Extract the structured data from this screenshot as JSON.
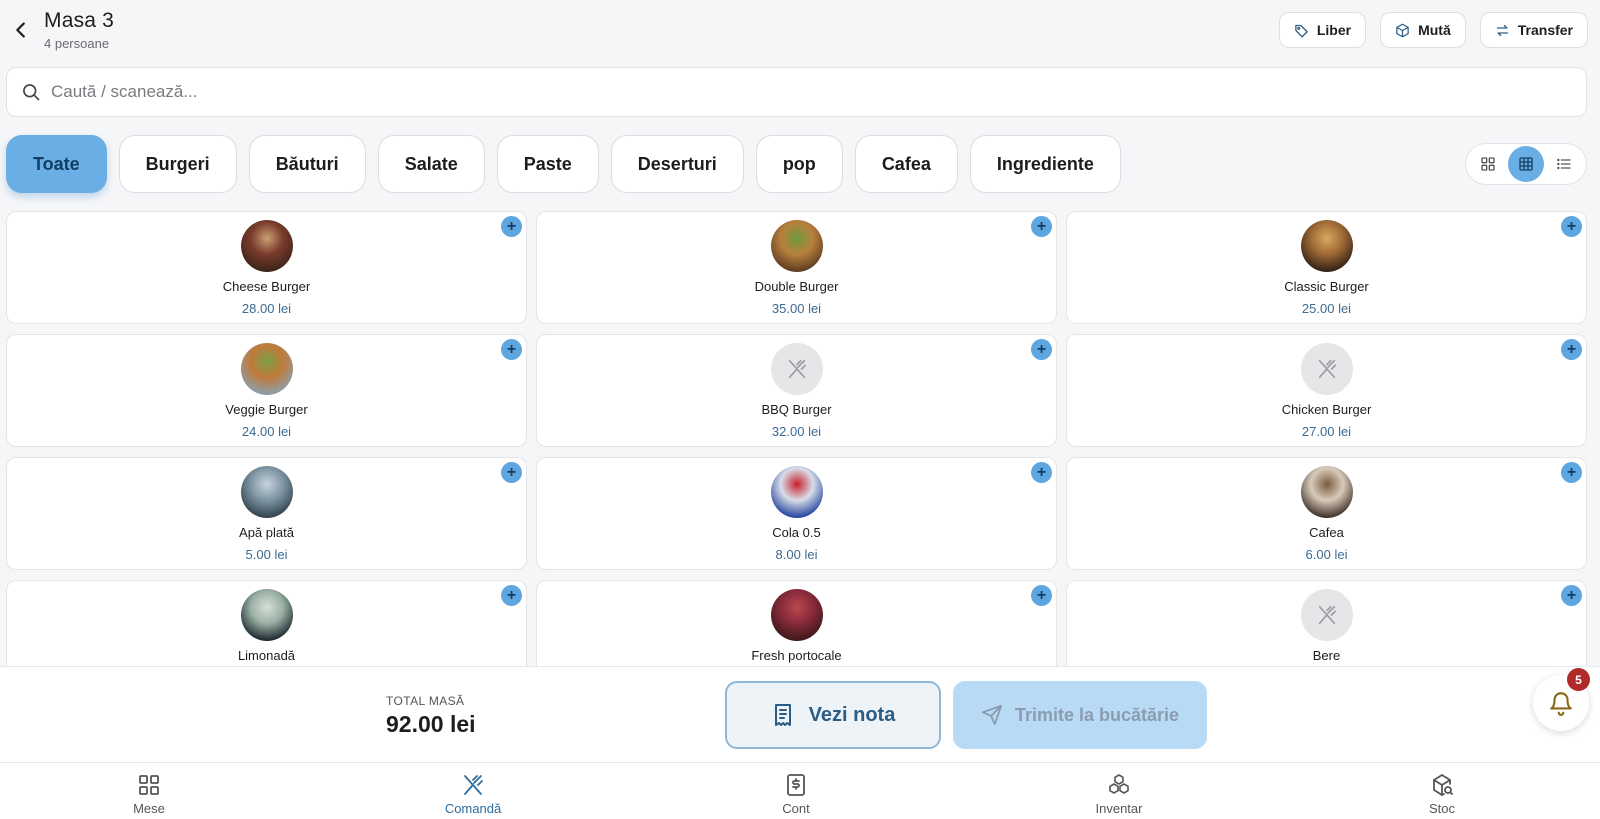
{
  "header": {
    "title": "Masa 3",
    "subtitle": "4 persoane",
    "actions": [
      {
        "label": "Liber",
        "icon": "tag-icon"
      },
      {
        "label": "Mută",
        "icon": "box-icon"
      },
      {
        "label": "Transfer",
        "icon": "swap-arrows-icon"
      }
    ]
  },
  "search": {
    "placeholder": "Caută / scanează..."
  },
  "categories": [
    {
      "label": "Toate",
      "active": true
    },
    {
      "label": "Burgeri"
    },
    {
      "label": "Băuturi"
    },
    {
      "label": "Salate"
    },
    {
      "label": "Paste"
    },
    {
      "label": "Deserturi"
    },
    {
      "label": "pop"
    },
    {
      "label": "Cafea"
    },
    {
      "label": "Ingrediente"
    }
  ],
  "view_modes": [
    "large-grid-icon",
    "compact-grid-icon",
    "list-icon"
  ],
  "products": [
    {
      "name": "Cheese Burger",
      "price": "28.00 lei",
      "thumb": "burger-photo",
      "colors": [
        "#3a2418",
        "#7a3b2c",
        "#c9a072"
      ]
    },
    {
      "name": "Double Burger",
      "price": "35.00 lei",
      "thumb": "burger-photo",
      "colors": [
        "#5a3a22",
        "#b8803c",
        "#6e9a3d"
      ]
    },
    {
      "name": "Classic Burger",
      "price": "25.00 lei",
      "thumb": "burger-photo",
      "colors": [
        "#2d1d14",
        "#a06a36",
        "#d8a860"
      ]
    },
    {
      "name": "Veggie Burger",
      "price": "24.00 lei",
      "thumb": "burger-photo",
      "colors": [
        "#8aa0b0",
        "#c07a3a",
        "#7aa048"
      ]
    },
    {
      "name": "BBQ Burger",
      "price": "32.00 lei",
      "thumb": "placeholder"
    },
    {
      "name": "Chicken Burger",
      "price": "27.00 lei",
      "thumb": "placeholder"
    },
    {
      "name": "Apă plată",
      "price": "5.00 lei",
      "thumb": "water-photo",
      "colors": [
        "#2f3f4a",
        "#7f96a4",
        "#c6d4dc"
      ]
    },
    {
      "name": "Cola 0.5",
      "price": "8.00 lei",
      "thumb": "cola-photo",
      "colors": [
        "#1d3f9a",
        "#d8dde8",
        "#c8202c"
      ]
    },
    {
      "name": "Cafea",
      "price": "6.00 lei",
      "thumb": "coffee-photo",
      "colors": [
        "#3a2a20",
        "#d8cbbb",
        "#7a5a40"
      ]
    },
    {
      "name": "Limonadă",
      "price": "",
      "thumb": "lemonade-photo",
      "colors": [
        "#16222c",
        "#9ab0a4",
        "#d8e0d8"
      ]
    },
    {
      "name": "Fresh portocale",
      "price": "",
      "thumb": "juice-photo",
      "colors": [
        "#3a1818",
        "#8a2a3a",
        "#b84a50"
      ]
    },
    {
      "name": "Bere",
      "price": "",
      "thumb": "placeholder"
    }
  ],
  "footer": {
    "total_label": "TOTAL MASĂ",
    "total_value": "92.00 lei",
    "bill_label": "Vezi nota",
    "kitchen_label": "Trimite la bucătărie",
    "notifications_count": "5"
  },
  "nav": [
    {
      "label": "Mese",
      "icon": "tables-grid-icon"
    },
    {
      "label": "Comandă",
      "icon": "utensils-icon",
      "active": true
    },
    {
      "label": "Cont",
      "icon": "receipt-dollar-icon"
    },
    {
      "label": "Inventar",
      "icon": "boxes-icon"
    },
    {
      "label": "Stoc",
      "icon": "package-search-icon"
    }
  ],
  "colors": {
    "accent": "#6aaee6",
    "price_text": "#3d6a91",
    "active_nav": "#2f6d9e",
    "badge": "#b02a2a"
  }
}
